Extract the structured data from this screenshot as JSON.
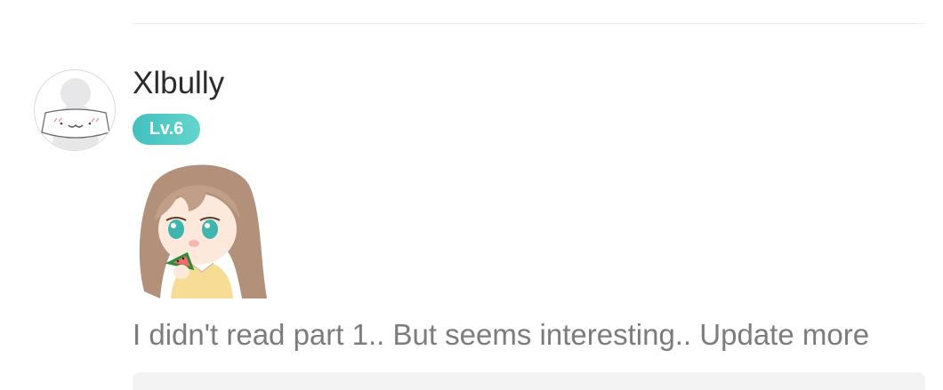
{
  "comment": {
    "username": "Xlbully",
    "level": "Lv.6",
    "text": "I didn't read part 1.. But seems interesting.. Update more"
  },
  "colors": {
    "level_badge": "#4cc9c6",
    "text_secondary": "#7c7c7c",
    "username": "#2b2b2b"
  }
}
